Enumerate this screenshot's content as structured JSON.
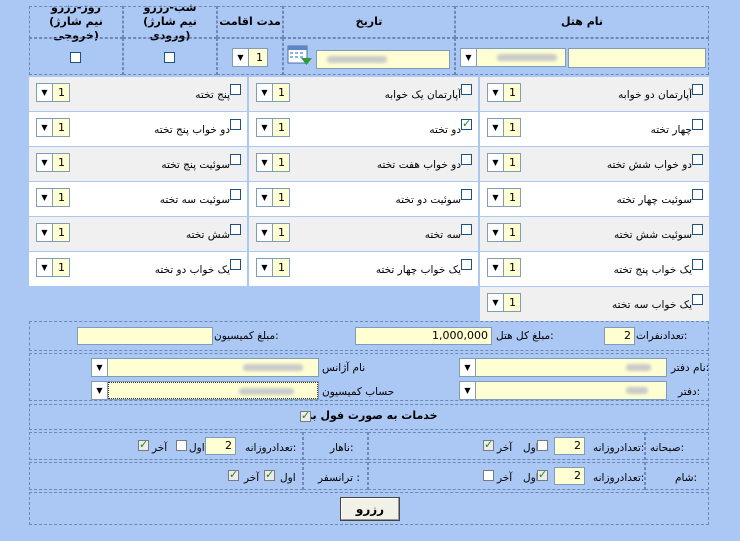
{
  "headers": {
    "hotel_name": "نام هتل",
    "date": "تاریخ",
    "stay_duration": "مدت اقامت",
    "night_reserve": "شب-رزرو\n(نیم شارژ ورودی)",
    "day_reserve": "روز-رزرو\n(نیم شارژ خروجی)"
  },
  "search": {
    "stay_value": "1"
  },
  "rooms_col1": [
    {
      "label": "آپارتمان دو خوابه",
      "checked": false,
      "value": "1"
    },
    {
      "label": "چهار تخته",
      "checked": false,
      "value": "1"
    },
    {
      "label": "دو خواب شش تخته",
      "checked": false,
      "value": "1"
    },
    {
      "label": "سوئیت چهار تخته",
      "checked": false,
      "value": "1"
    },
    {
      "label": "سوئیت شش تخته",
      "checked": false,
      "value": "1"
    },
    {
      "label": "یک خواب پنج تخته",
      "checked": false,
      "value": "1"
    },
    {
      "label": "یک خواب سه تخته",
      "checked": false,
      "value": "1"
    }
  ],
  "rooms_col2": [
    {
      "label": "آپارتمان یک خوابه",
      "checked": false,
      "value": "1"
    },
    {
      "label": "دو تخته",
      "checked": true,
      "value": "1"
    },
    {
      "label": "دو خواب هفت تخته",
      "checked": false,
      "value": "1"
    },
    {
      "label": "سوئیت دو تخته",
      "checked": false,
      "value": "1"
    },
    {
      "label": "سه تخته",
      "checked": false,
      "value": "1"
    },
    {
      "label": "یک خواب چهار تخته",
      "checked": false,
      "value": "1"
    }
  ],
  "rooms_col3": [
    {
      "label": "پنج تخته",
      "checked": false,
      "value": "1"
    },
    {
      "label": "دو خواب پنج تخته",
      "checked": false,
      "value": "1"
    },
    {
      "label": "سوئیت پنج تخته",
      "checked": false,
      "value": "1"
    },
    {
      "label": "سوئیت سه تخته",
      "checked": false,
      "value": "1"
    },
    {
      "label": "شش تخته",
      "checked": false,
      "value": "1"
    },
    {
      "label": "یک خواب دو تخته",
      "checked": false,
      "value": "1"
    }
  ],
  "summary": {
    "persons_label": "تعدادنفرات:",
    "persons_value": "2",
    "total_label": "مبلغ کل هتل:",
    "total_value": "1,000,000",
    "commission_label": "مبلغ کمیسیون:",
    "commission_value": ""
  },
  "office": {
    "office_name_label": "نام دفتر:",
    "agency_name_label": "نام آژانس",
    "office_label": "دفتر:",
    "commission_account_label": "حساب کمیسیون"
  },
  "services": {
    "full_board_label": "خدمات به صورت فول برد",
    "full_board_checked": true
  },
  "meals": {
    "breakfast_label": "صبحانه:",
    "lunch_label": "ناهار:",
    "dinner_label": "شام:",
    "transfer_label": "ترانسفر :",
    "daily_count_label": "تعدادروزانه:",
    "first_label": "اول",
    "last_label": "آخر",
    "breakfast": {
      "count": "2",
      "first": false,
      "last": true
    },
    "lunch": {
      "count": "2",
      "first": false,
      "last": true
    },
    "dinner": {
      "count": "2",
      "first": true,
      "last": false
    },
    "transfer": {
      "first": true,
      "last": true
    }
  },
  "actions": {
    "reserve_label": "رزرو"
  }
}
